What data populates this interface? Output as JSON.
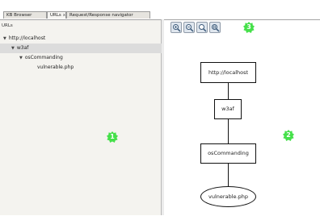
{
  "tabs": [
    {
      "label": "KB Browser",
      "active": false
    },
    {
      "label": "URLs",
      "close": "x",
      "active": true
    },
    {
      "label": "Request/Response navigator",
      "active": false
    }
  ],
  "left_pane": {
    "column_header": "URLs",
    "tree": [
      {
        "label": "http://localhost",
        "expanded": true
      },
      {
        "label": "w3af",
        "expanded": true
      },
      {
        "label": "osCommanding",
        "expanded": true
      },
      {
        "label": "vulnerable.php"
      }
    ]
  },
  "toolbar": {
    "buttons": [
      "zoom-in-icon",
      "zoom-out-icon",
      "zoom-fit-icon",
      "zoom-reset-icon"
    ]
  },
  "badges": {
    "left": "1",
    "right": "2",
    "toolbar": "3"
  },
  "graph": {
    "nodes": [
      "http://localhost",
      "w3af",
      "osCommanding",
      "vulnerable.php"
    ]
  },
  "colors": {
    "badge": "#45e04a",
    "pane": "#f4f3ef"
  }
}
